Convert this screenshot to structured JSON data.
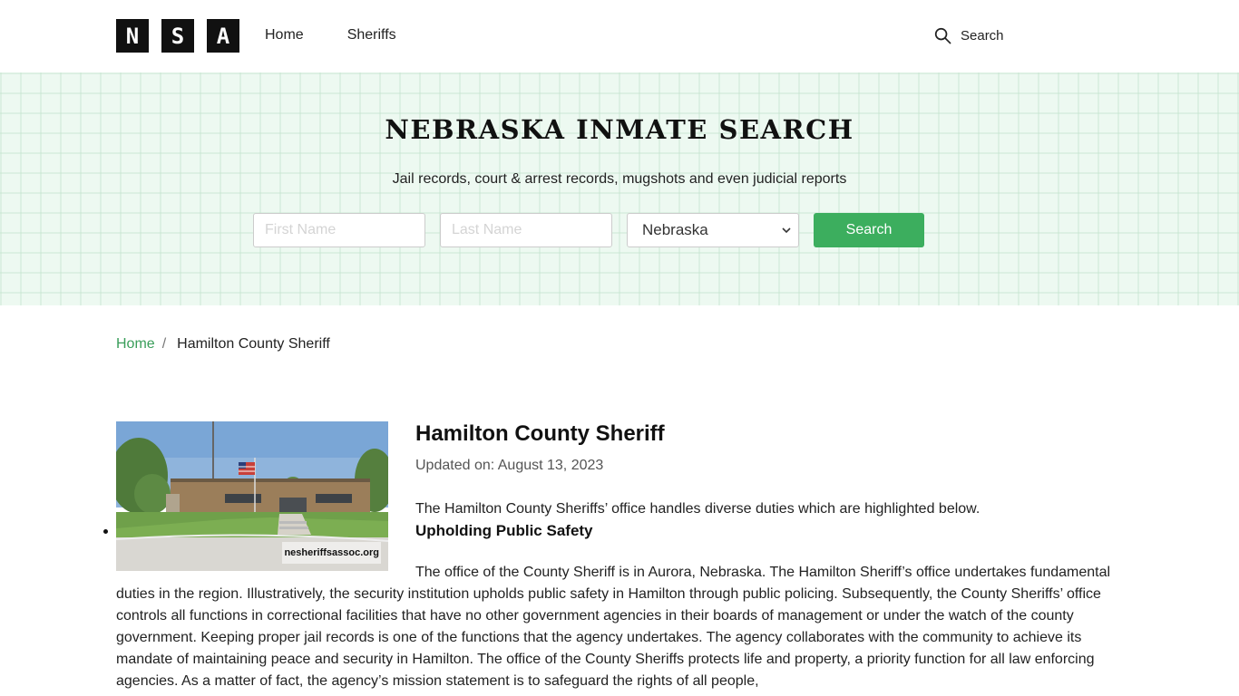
{
  "header": {
    "logo_letters": [
      "N",
      "S",
      "A"
    ],
    "nav": [
      {
        "label": "Home"
      },
      {
        "label": "Sheriffs"
      }
    ],
    "search_label": "Search"
  },
  "hero": {
    "title": "NEBRASKA INMATE SEARCH",
    "subtitle": "Jail records, court & arrest records, mugshots and even judicial reports",
    "first_name_placeholder": "First Name",
    "last_name_placeholder": "Last Name",
    "state_selected": "Nebraska",
    "search_button": "Search"
  },
  "breadcrumb": {
    "home": "Home",
    "separator": "/",
    "current": "Hamilton County Sheriff"
  },
  "article": {
    "image_caption": "nesheriffsassoc.org",
    "title": "Hamilton County Sheriff",
    "updated": "Updated on: August 13, 2023",
    "intro": "The Hamilton County Sheriffs’ office handles diverse duties which are highlighted below.",
    "bullets": [
      "Upholding Public Safety"
    ],
    "paragraph": "The office of the County Sheriff is in Aurora, Nebraska. The Hamilton Sheriff’s office undertakes fundamental duties in the region. Illustratively, the security institution upholds public safety in Hamilton through public policing. Subsequently, the County Sheriffs’ office controls all functions in correctional facilities that have no other government agencies in their boards of management or under the watch of the county government. Keeping proper jail records is one of the functions that the agency undertakes. The agency collaborates with the community to achieve its mandate of maintaining peace and security in Hamilton. The office of the County Sheriffs protects life and property, a priority function for all law enforcing agencies. As a matter of fact, the agency’s mission statement is to safeguard the rights of all people,"
  },
  "colors": {
    "accent_green": "#3cae5e",
    "hero_bg": "#edf9f1",
    "link_green": "#3a9e5a"
  }
}
